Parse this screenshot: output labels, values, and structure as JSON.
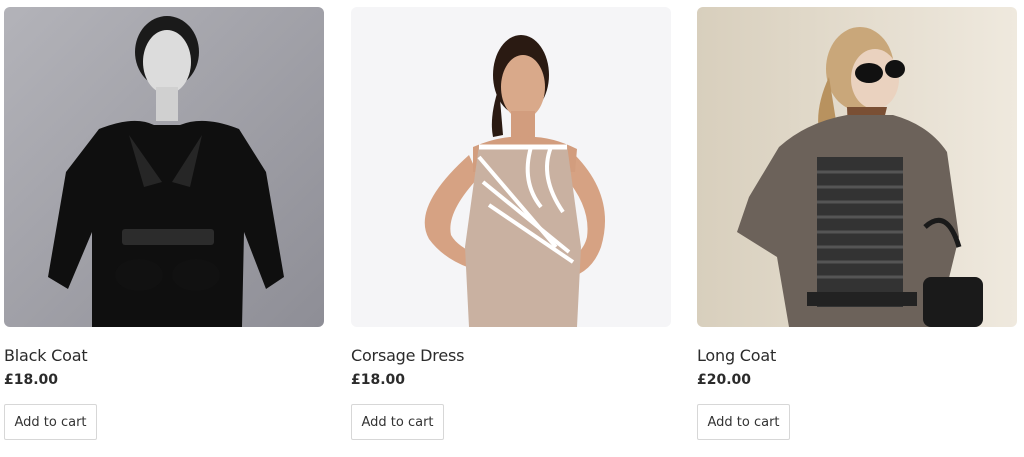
{
  "products": [
    {
      "name": "Black Coat",
      "price": "£18.00",
      "button_label": "Add to cart",
      "image_icon": "product-photo-black-coat"
    },
    {
      "name": "Corsage Dress",
      "price": "£18.00",
      "button_label": "Add to cart",
      "image_icon": "product-photo-corsage-dress"
    },
    {
      "name": "Long Coat",
      "price": "£20.00",
      "button_label": "Add to cart",
      "image_icon": "product-photo-long-coat"
    }
  ],
  "colors": {
    "text": "#2b2b2b",
    "button_border": "#d7d7d7",
    "black_coat_bg": "#9c9ca4",
    "corsage_bg": "#f4f4f6",
    "long_coat_bg": "#e3dccd"
  }
}
